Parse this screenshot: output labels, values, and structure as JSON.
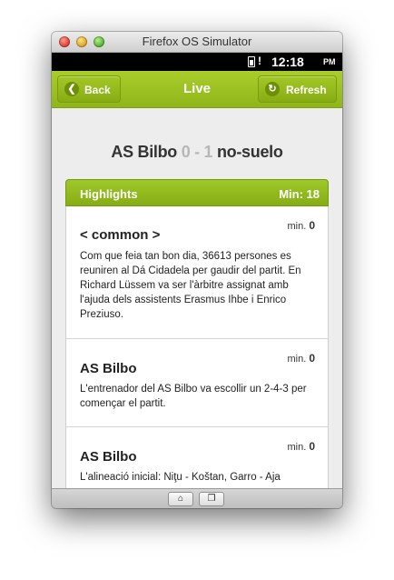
{
  "window": {
    "title": "Firefox OS Simulator"
  },
  "statusbar": {
    "time": "12:18",
    "ampm": "PM",
    "alert": "!"
  },
  "header": {
    "back_label": "Back",
    "title": "Live",
    "refresh_label": "Refresh"
  },
  "match": {
    "home_team": "AS Bilbo",
    "home_score": "0",
    "separator": "-",
    "away_score": "1",
    "away_team": "no-suelo"
  },
  "highlights": {
    "label": "Highlights",
    "minute_label": "Min: 18"
  },
  "events": [
    {
      "min_label": "min.",
      "minute": "0",
      "team": "< common >",
      "text": "Com que feia tan bon dia, 36613 persones es reuniren al Dá Cidadela per gaudir del partit. En Richard Lüssem va ser l'àrbitre assignat amb l'ajuda dels assistents Erasmus Ihbe i Enrico Preziuso."
    },
    {
      "min_label": "min.",
      "minute": "0",
      "team": "AS Bilbo",
      "text": "L'entrenador del AS Bilbo va escollir un 2-4-3 per començar el partit."
    },
    {
      "min_label": "min.",
      "minute": "0",
      "team": "AS Bilbo",
      "text": "L'alineació inicial: Niţu - Koštan, Garro - Aja"
    }
  ],
  "icons": {
    "back": "back-arrow-icon",
    "refresh": "refresh-icon",
    "home": "home-icon",
    "cards": "cards-icon"
  },
  "colors": {
    "accent": "#96bd1f",
    "header_text": "#ffffff",
    "score_muted": "#b7b7b7"
  }
}
